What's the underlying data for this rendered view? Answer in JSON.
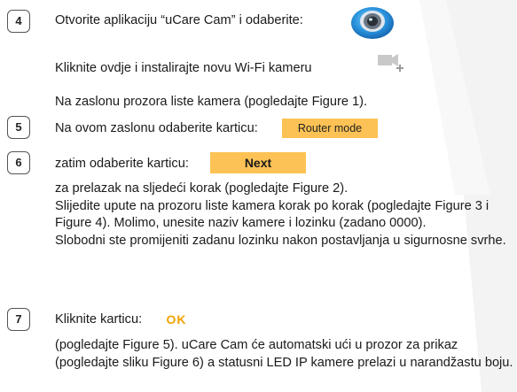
{
  "steps": {
    "s4": {
      "number": "4",
      "line1": "Otvorite aplikaciju “uCare Cam” i odaberite:",
      "line2": "Kliknite ovdje i instalirajte novu Wi-Fi kameru",
      "line3": "Na zaslonu prozora liste kamera (pogledajte Figure 1)."
    },
    "s5": {
      "number": "5",
      "line1": "Na ovom zaslonu odaberite karticu:",
      "button": "Router mode"
    },
    "s6": {
      "number": "6",
      "line1": "zatim odaberite karticu:",
      "button": "Next",
      "p1": "za prelazak na sljedeći korak (pogledajte Figure 2).",
      "p2": "Slijedite upute na prozoru liste kamera korak po korak (pogledajte Figure 3 i Figure 4). Molimo, unesite naziv kamere i lozinku (zadano 0000).",
      "p3": "Slobodni ste promijeniti zadanu lozinku nakon postavljanja u sigurnosne svrhe."
    },
    "s7": {
      "number": "7",
      "line1": "Kliknite karticu:",
      "button": "OK",
      "p1": "(pogledajte Figure 5). uCare Cam će automatski ući u prozor za prikaz (pogledajte sliku Figure 6) a statusni LED IP kamere prelazi u narandžastu boju."
    }
  },
  "icons": {
    "app": "ucare-cam-app-icon",
    "camera": "video-camera-add-icon"
  },
  "colors": {
    "button_orange": "#fdc255",
    "ok_text": "#f3a200"
  }
}
